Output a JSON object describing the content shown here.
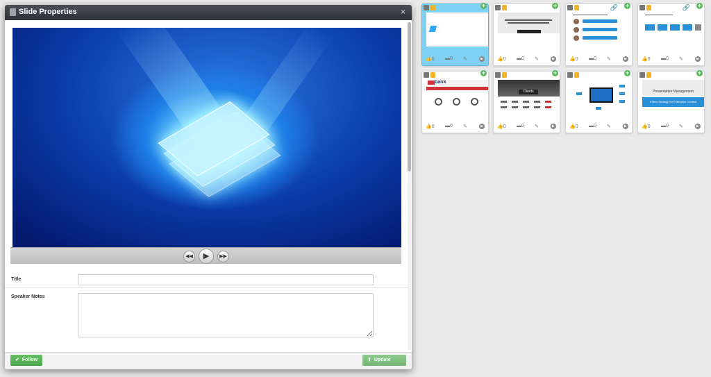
{
  "modal": {
    "title": "Slide Properties",
    "close_glyph": "×",
    "video_controls": {
      "rewind_glyph": "◀◀",
      "play_glyph": "▶",
      "forward_glyph": "▶▶"
    },
    "fields": {
      "title_label": "Title",
      "title_value": "",
      "notes_label": "Speaker Notes",
      "notes_value": ""
    },
    "footer": {
      "follow_label": "Follow",
      "follow_icon": "check-icon",
      "update_tags_label": "Update Tags",
      "update_tags_icon": "upload-icon"
    }
  },
  "thumbnails": [
    {
      "kind": "shufflrr",
      "logo": "shufflrr",
      "link": false,
      "likes": "0",
      "comments": "0",
      "selected": true
    },
    {
      "kind": "text",
      "link": false,
      "likes": "0",
      "comments": "0",
      "selected": false
    },
    {
      "kind": "bullets",
      "link": true,
      "likes": "0",
      "comments": "0",
      "selected": false
    },
    {
      "kind": "boxes",
      "link": true,
      "likes": "0",
      "comments": "0",
      "selected": false
    },
    {
      "kind": "bank",
      "logo": "bank",
      "link": false,
      "likes": "0",
      "comments": "0",
      "selected": false
    },
    {
      "kind": "clients",
      "header": "Clients",
      "link": false,
      "likes": "0",
      "comments": "0",
      "selected": false
    },
    {
      "kind": "diagram",
      "link": false,
      "likes": "0",
      "comments": "0",
      "selected": false
    },
    {
      "kind": "pm",
      "title": "Presentation Management",
      "subtitle": "A New Strategy for Enterprise Content",
      "link": false,
      "likes": "0",
      "comments": "0",
      "selected": false
    }
  ],
  "colors": {
    "header_bg": "#2d3137",
    "accent_green": "#5cb85c",
    "selected_card": "#7fd1f3",
    "thumb_blue": "#2a8fd6"
  }
}
